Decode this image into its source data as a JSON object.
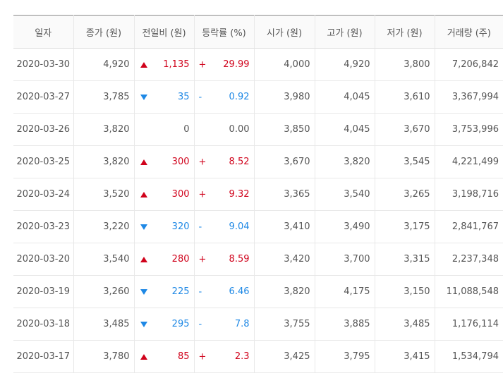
{
  "colors": {
    "up": "#d0021b",
    "down": "#1e88e5",
    "neutral": "#555555"
  },
  "table": {
    "headers": [
      "일자",
      "종가 (원)",
      "전일비 (원)",
      "등락률 (%)",
      "시가 (원)",
      "고가 (원)",
      "저가 (원)",
      "거래량 (주)"
    ],
    "rows": [
      {
        "date": "2020-03-30",
        "close": "4,920",
        "dir": "up",
        "change": "1,135",
        "sign": "+",
        "rate": "29.99",
        "open": "4,000",
        "high": "4,920",
        "low": "3,800",
        "volume": "7,206,842"
      },
      {
        "date": "2020-03-27",
        "close": "3,785",
        "dir": "down",
        "change": "35",
        "sign": "-",
        "rate": "0.92",
        "open": "3,980",
        "high": "4,045",
        "low": "3,610",
        "volume": "3,367,994"
      },
      {
        "date": "2020-03-26",
        "close": "3,820",
        "dir": "none",
        "change": "0",
        "sign": "",
        "rate": "0.00",
        "open": "3,850",
        "high": "4,045",
        "low": "3,670",
        "volume": "3,753,996"
      },
      {
        "date": "2020-03-25",
        "close": "3,820",
        "dir": "up",
        "change": "300",
        "sign": "+",
        "rate": "8.52",
        "open": "3,670",
        "high": "3,820",
        "low": "3,545",
        "volume": "4,221,499"
      },
      {
        "date": "2020-03-24",
        "close": "3,520",
        "dir": "up",
        "change": "300",
        "sign": "+",
        "rate": "9.32",
        "open": "3,365",
        "high": "3,540",
        "low": "3,265",
        "volume": "3,198,716"
      },
      {
        "date": "2020-03-23",
        "close": "3,220",
        "dir": "down",
        "change": "320",
        "sign": "-",
        "rate": "9.04",
        "open": "3,410",
        "high": "3,490",
        "low": "3,175",
        "volume": "2,841,767"
      },
      {
        "date": "2020-03-20",
        "close": "3,540",
        "dir": "up",
        "change": "280",
        "sign": "+",
        "rate": "8.59",
        "open": "3,420",
        "high": "3,700",
        "low": "3,315",
        "volume": "2,237,348"
      },
      {
        "date": "2020-03-19",
        "close": "3,260",
        "dir": "down",
        "change": "225",
        "sign": "-",
        "rate": "6.46",
        "open": "3,820",
        "high": "4,175",
        "low": "3,150",
        "volume": "11,088,548"
      },
      {
        "date": "2020-03-18",
        "close": "3,485",
        "dir": "down",
        "change": "295",
        "sign": "-",
        "rate": "7.8",
        "open": "3,755",
        "high": "3,885",
        "low": "3,485",
        "volume": "1,176,114"
      },
      {
        "date": "2020-03-17",
        "close": "3,780",
        "dir": "up",
        "change": "85",
        "sign": "+",
        "rate": "2.3",
        "open": "3,425",
        "high": "3,795",
        "low": "3,415",
        "volume": "1,534,794"
      }
    ]
  }
}
